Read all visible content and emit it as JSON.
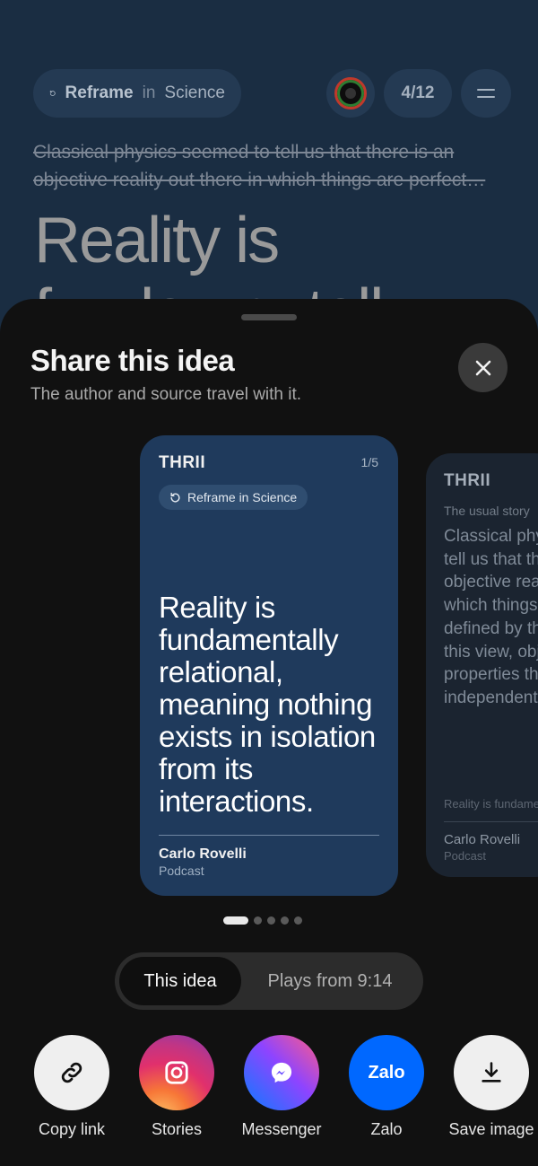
{
  "background": {
    "topic_pill": {
      "label": "Reframe",
      "connector": "in",
      "topic": "Science",
      "icon": "reframe-icon"
    },
    "progress": "4/12",
    "struck_text": {
      "line1": "Classical physics seemed to tell us that there is an",
      "line2": "objective reality out there in which things are perfect…"
    },
    "headline": "Reality is fundamentally"
  },
  "sheet": {
    "title": "Share this idea",
    "subtitle": "The author and source travel with it.",
    "close_icon": "close-icon"
  },
  "cards": {
    "main": {
      "brand": "THRII",
      "page": "1/5",
      "tag": "Reframe in Science",
      "quote": "Reality is fundamentally relational, meaning nothing exists in isolation from its interactions.",
      "author": "Carlo Rovelli",
      "source": "Podcast"
    },
    "next": {
      "brand": "THRII",
      "label": "The usual story",
      "body": "Classical physics seemed to tell us that there is an objective reality out there in which things are perfectly defined by their properties. In this view, objects have properties that are entirely independent of the rest of the",
      "footer": "Reality is fundamentally relational",
      "author": "Carlo Rovelli",
      "source": "Podcast"
    }
  },
  "pager": {
    "count": 5,
    "active": 0
  },
  "segmented": {
    "selected": "This idea",
    "other": "Plays from 9:14"
  },
  "share_targets": [
    {
      "label": "Copy link",
      "icon": "link-icon"
    },
    {
      "label": "Stories",
      "icon": "instagram-icon"
    },
    {
      "label": "Messenger",
      "icon": "messenger-icon"
    },
    {
      "label": "Zalo",
      "icon": "zalo-icon",
      "icon_text": "Zalo"
    },
    {
      "label": "Save image",
      "icon": "download-icon"
    }
  ],
  "colors": {
    "sheet_bg": "#111111",
    "card_bg": "#1f3a5c",
    "background_header": "#1a2d42",
    "zalo_blue": "#0068ff"
  }
}
